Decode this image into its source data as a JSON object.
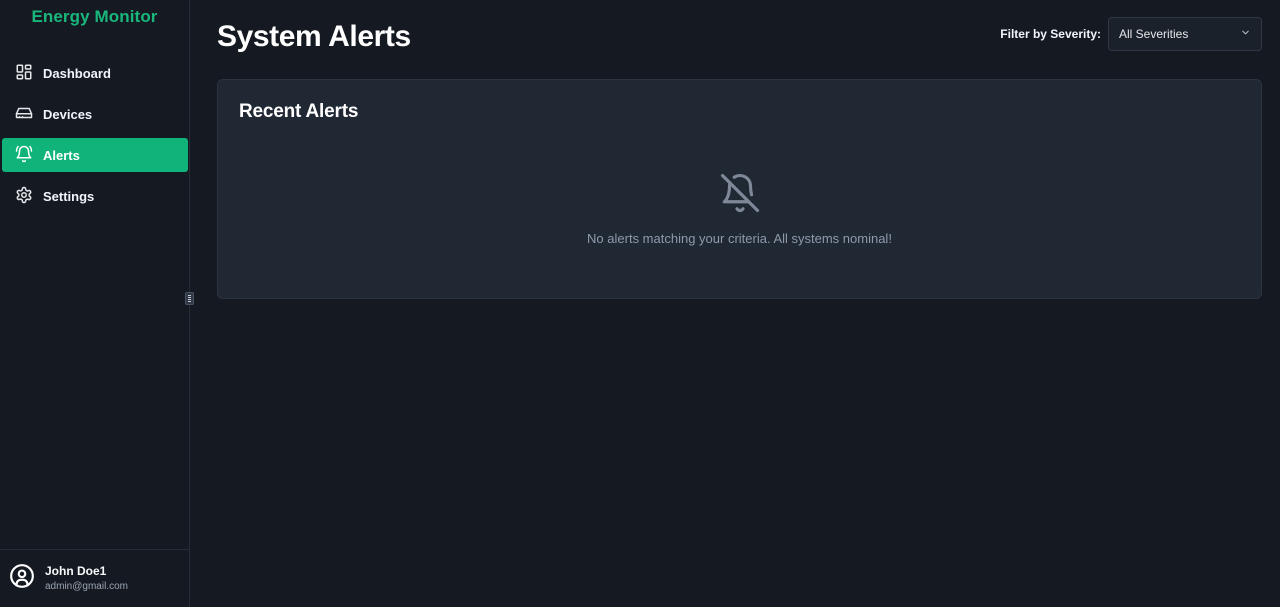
{
  "app": {
    "brand": "Energy Monitor"
  },
  "sidebar": {
    "items": [
      {
        "label": "Dashboard",
        "icon": "dashboard-grid-icon",
        "active": false
      },
      {
        "label": "Devices",
        "icon": "device-drive-icon",
        "active": false
      },
      {
        "label": "Alerts",
        "icon": "bell-icon",
        "active": true
      },
      {
        "label": "Settings",
        "icon": "gear-icon",
        "active": false
      }
    ],
    "user": {
      "name": "John Doe1",
      "email": "admin@gmail.com",
      "icon": "user-circle-icon"
    }
  },
  "header": {
    "title": "System Alerts",
    "filter_label": "Filter by Severity:",
    "filter_value": "All Severities"
  },
  "panel": {
    "title": "Recent Alerts",
    "empty_icon": "bell-off-icon",
    "empty_message": "No alerts matching your criteria. All systems nominal!"
  },
  "colors": {
    "accent": "#10b47a",
    "brand_text": "#19b77c",
    "background": "#151a22",
    "panel": "#202833"
  }
}
